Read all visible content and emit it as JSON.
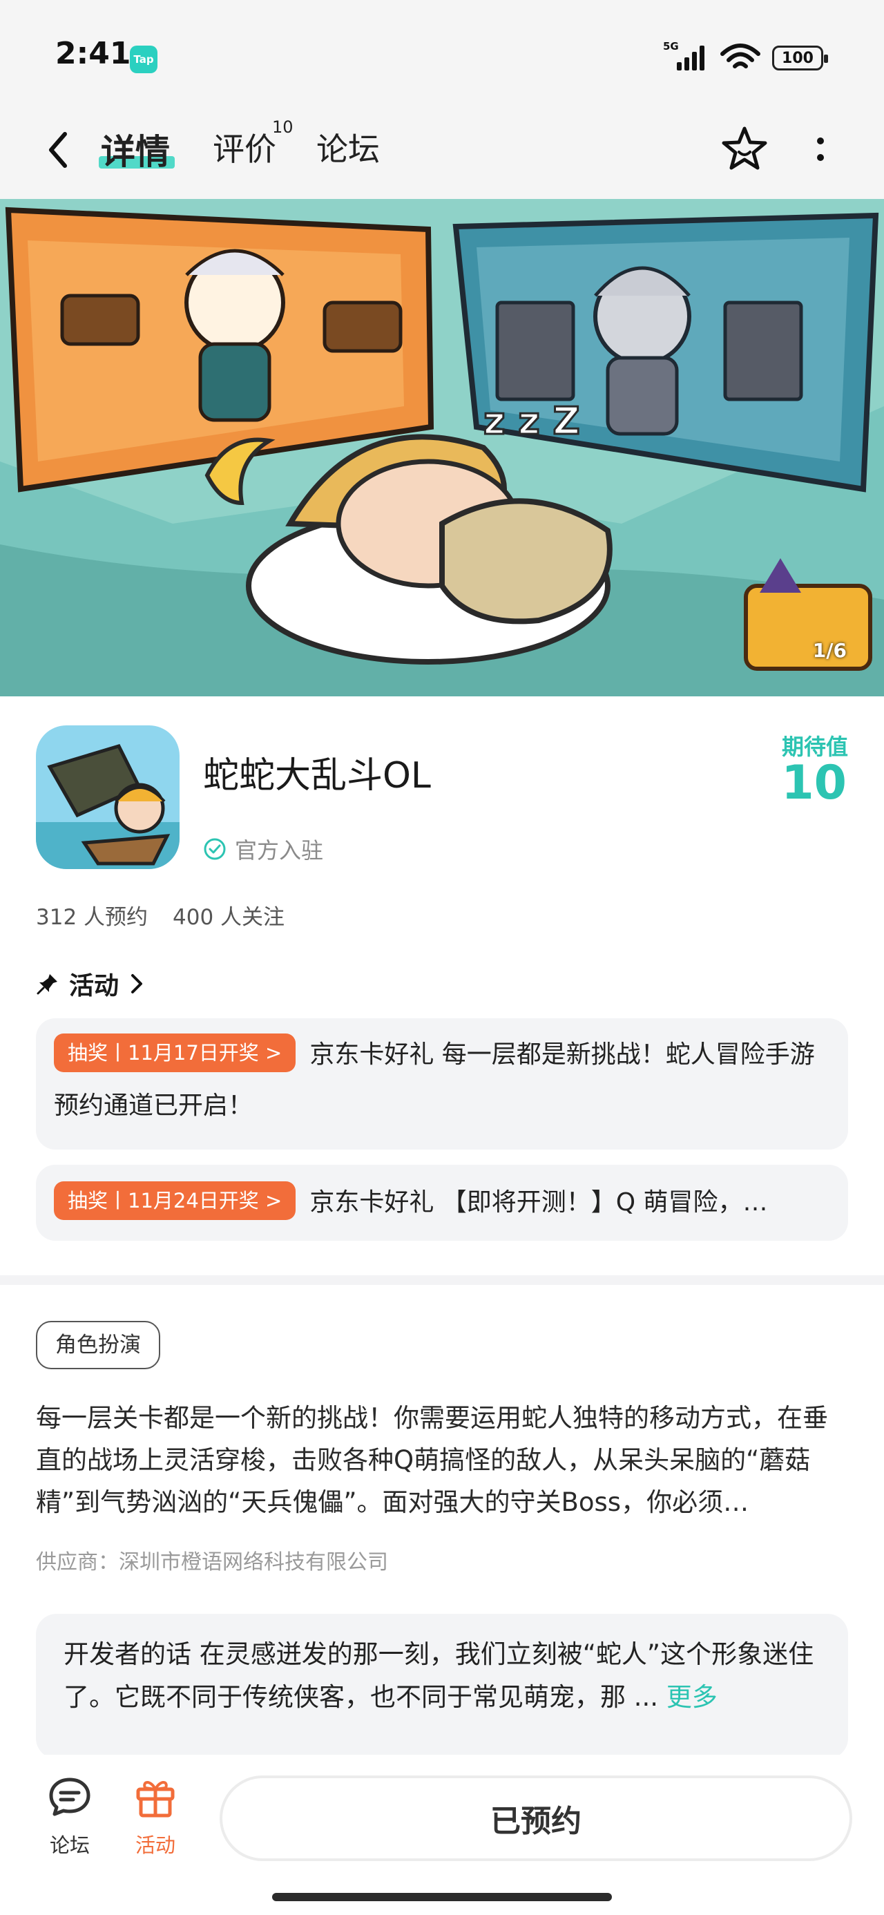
{
  "status_bar": {
    "time": "2:41",
    "app_badge": "Tap",
    "network": "5G",
    "battery": "100"
  },
  "nav": {
    "tabs": [
      {
        "label": "详情",
        "active": true
      },
      {
        "label": "评价",
        "count": "10"
      },
      {
        "label": "论坛"
      }
    ]
  },
  "banner": {
    "counter": "1/6"
  },
  "app": {
    "name": "蛇蛇大乱斗OL",
    "verified_label": "官方入驻",
    "expect_label": "期待值",
    "expect_value": "10",
    "reservations": "312 人预约",
    "followers": "400 人关注"
  },
  "activity": {
    "header": "活动",
    "items": [
      {
        "tag": "抽奖丨11月17日开奖 >",
        "text": "京东卡好礼 每一层都是新挑战！蛇人冒险手游预约通道已开启！"
      },
      {
        "tag": "抽奖丨11月24日开奖 >",
        "text": "京东卡好礼 【即将开测！】Q 萌冒险，…"
      }
    ]
  },
  "genre": "角色扮演",
  "description": "每一层关卡都是一个新的挑战！你需要运用蛇人独特的移动方式，在垂直的战场上灵活穿梭，击败各种Q萌搞怪的敌人，从呆头呆脑的“蘑菇精”到气势汹汹的“天兵傀儡”。面对强大的守关Boss，你必须…",
  "supplier": "供应商：深圳市橙语网络科技有限公司",
  "developer_note": {
    "label": "开发者的话",
    "text": "在灵感迸发的那一刻，我们立刻被“蛇人”这个形象迷住了。它既不同于传统侠客，也不同于常见萌宠，那 ...",
    "more": "更多"
  },
  "bottom_bar": {
    "forum_label": "论坛",
    "activity_label": "活动",
    "reserve_label": "已预约"
  },
  "colors": {
    "accent": "#2cc4b2",
    "orange": "#f26d3a"
  }
}
